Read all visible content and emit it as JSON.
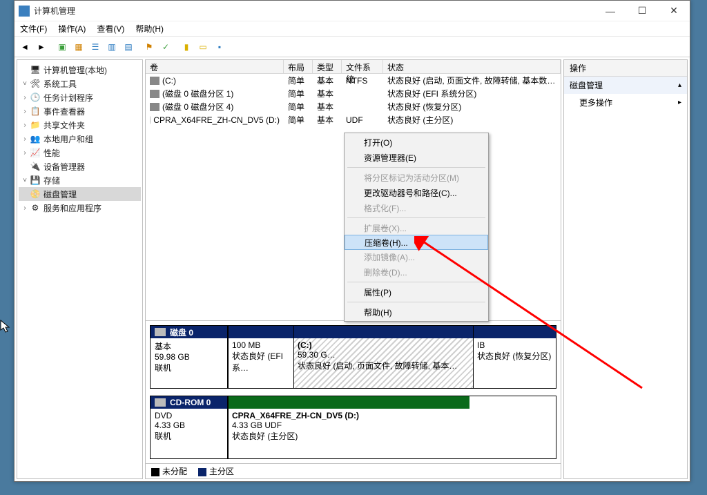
{
  "window": {
    "title": "计算机管理"
  },
  "menubar": {
    "file": "文件(F)",
    "action": "操作(A)",
    "view": "查看(V)",
    "help": "帮助(H)"
  },
  "tree": {
    "root": "计算机管理(本地)",
    "systools": "系统工具",
    "task": "任务计划程序",
    "event": "事件查看器",
    "shared": "共享文件夹",
    "users": "本地用户和组",
    "perf": "性能",
    "devmgr": "设备管理器",
    "storage": "存储",
    "diskmgmt": "磁盘管理",
    "services": "服务和应用程序"
  },
  "vol_header": {
    "vol": "卷",
    "layout": "布局",
    "type": "类型",
    "fs": "文件系统",
    "status": "状态"
  },
  "volumes": [
    {
      "name": "(C:)",
      "layout": "简单",
      "type": "基本",
      "fs": "NTFS",
      "status": "状态良好 (启动, 页面文件, 故障转储, 基本数据分…"
    },
    {
      "name": "(磁盘 0 磁盘分区 1)",
      "layout": "简单",
      "type": "基本",
      "fs": "",
      "status": "状态良好 (EFI 系统分区)"
    },
    {
      "name": "(磁盘 0 磁盘分区 4)",
      "layout": "简单",
      "type": "基本",
      "fs": "",
      "status": "状态良好 (恢复分区)"
    },
    {
      "name": "CPRA_X64FRE_ZH-CN_DV5 (D:)",
      "layout": "简单",
      "type": "基本",
      "fs": "UDF",
      "status": "状态良好 (主分区)"
    }
  ],
  "disk0": {
    "title": "磁盘 0",
    "type": "基本",
    "size": "59.98 GB",
    "state": "联机",
    "p1_size": "100 MB",
    "p1_status": "状态良好 (EFI 系…",
    "p2_name": "(C:)",
    "p2_size": "59.30 G…",
    "p2_status": "状态良好 (启动, 页面文件, 故障转储, 基本…",
    "p3_size": "IB",
    "p3_status": "状态良好 (恢复分区)"
  },
  "cdrom": {
    "title": "CD-ROM 0",
    "type": "DVD",
    "size": "4.33 GB",
    "state": "联机",
    "p_name": "CPRA_X64FRE_ZH-CN_DV5  (D:)",
    "p_size": "4.33 GB UDF",
    "p_status": "状态良好 (主分区)"
  },
  "legend": {
    "unalloc": "未分配",
    "primary": "主分区"
  },
  "actions": {
    "header": "操作",
    "section": "磁盘管理",
    "more": "更多操作"
  },
  "ctx": {
    "open": "打开(O)",
    "explorer": "资源管理器(E)",
    "mark": "将分区标记为活动分区(M)",
    "change": "更改驱动器号和路径(C)...",
    "format": "格式化(F)...",
    "extend": "扩展卷(X)...",
    "shrink": "压缩卷(H)...",
    "mirror": "添加镜像(A)...",
    "delete": "删除卷(D)...",
    "prop": "属性(P)",
    "help": "帮助(H)"
  }
}
